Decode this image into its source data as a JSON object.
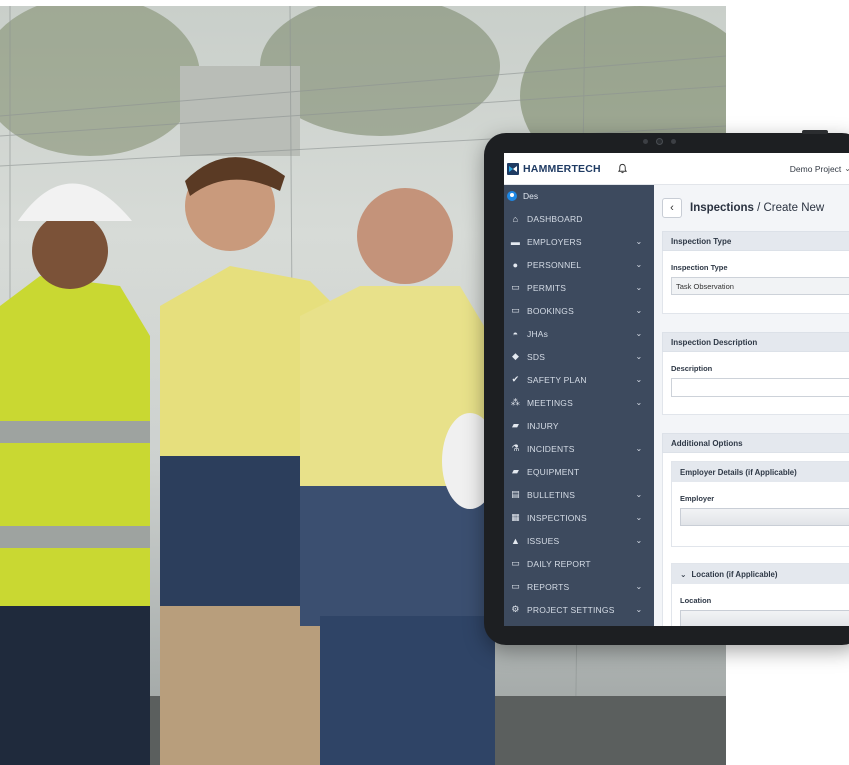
{
  "photo": {
    "alt_icon": "construction-workers-photo"
  },
  "topbar": {
    "brand": "HAMMERTECH",
    "project": "Demo Project"
  },
  "sidebar": {
    "user": "Des",
    "items": [
      {
        "label": "Dashboard",
        "icon": "home-icon",
        "chevron": false
      },
      {
        "label": "Employers",
        "icon": "briefcase-icon",
        "chevron": true
      },
      {
        "label": "Personnel",
        "icon": "person-icon",
        "chevron": true
      },
      {
        "label": "Permits",
        "icon": "card-icon",
        "chevron": true
      },
      {
        "label": "Bookings",
        "icon": "card-icon",
        "chevron": true
      },
      {
        "label": "JHAs",
        "icon": "hardhat-icon",
        "chevron": true
      },
      {
        "label": "SDS",
        "icon": "diamond-icon",
        "chevron": true
      },
      {
        "label": "Safety Plan",
        "icon": "check-circle-icon",
        "chevron": true
      },
      {
        "label": "Meetings",
        "icon": "group-icon",
        "chevron": true
      },
      {
        "label": "Injury",
        "icon": "bandage-icon",
        "chevron": false
      },
      {
        "label": "Incidents",
        "icon": "flask-icon",
        "chevron": true
      },
      {
        "label": "Equipment",
        "icon": "truck-icon",
        "chevron": false
      },
      {
        "label": "Bulletins",
        "icon": "document-icon",
        "chevron": true
      },
      {
        "label": "Inspections",
        "icon": "clipboard-icon",
        "chevron": true
      },
      {
        "label": "Issues",
        "icon": "warning-icon",
        "chevron": true
      },
      {
        "label": "Daily Report",
        "icon": "calendar-icon",
        "chevron": false
      },
      {
        "label": "Reports",
        "icon": "card-icon",
        "chevron": true
      },
      {
        "label": "Project Settings",
        "icon": "gear-icon",
        "chevron": true
      }
    ]
  },
  "main": {
    "title_bold": "Inspections",
    "title_rest": " / Create New",
    "inspection_type": {
      "section": "Inspection Type",
      "label": "Inspection Type",
      "value": "Task Observation"
    },
    "inspection_description": {
      "section": "Inspection Description",
      "label": "Description",
      "value": ""
    },
    "additional_options": {
      "section": "Additional Options",
      "employer_section": "Employer Details (if Applicable)",
      "employer_label": "Employer",
      "location_section": "Location (if Applicable)",
      "location_label": "Location"
    }
  },
  "colors": {
    "sidebar_bg": "#3d4a5e",
    "brand_blue": "#1f3b63",
    "accent_blue": "#1e88e5"
  }
}
